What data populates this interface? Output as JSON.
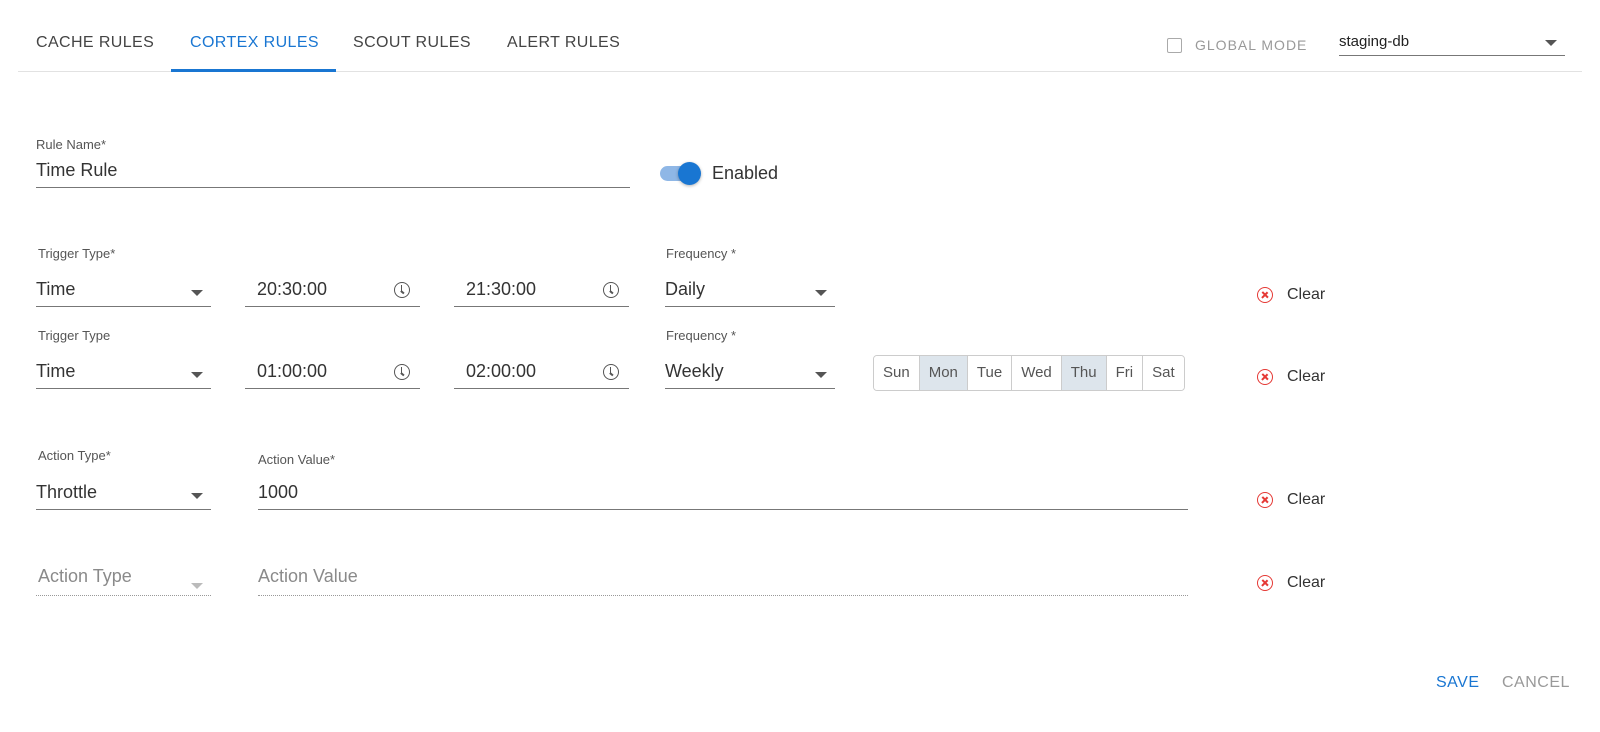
{
  "tabs": [
    {
      "label": "CACHE RULES"
    },
    {
      "label": "CORTEX RULES"
    },
    {
      "label": "SCOUT RULES"
    },
    {
      "label": "ALERT RULES"
    }
  ],
  "active_tab": "CORTEX RULES",
  "global_mode": {
    "label": "GLOBAL MODE",
    "checked": false
  },
  "db_select": {
    "value": "staging-db"
  },
  "rule_name": {
    "label": "Rule Name",
    "required_mark": "*",
    "value": "Time Rule"
  },
  "enabled_toggle": {
    "label": "Enabled",
    "on": true
  },
  "triggers": [
    {
      "type_label": "Trigger Type*",
      "type_value": "Time",
      "start": "20:30:00",
      "end": "21:30:00",
      "freq_label": "Frequency *",
      "freq_value": "Daily",
      "clear": "Clear"
    },
    {
      "type_label": "Trigger Type",
      "type_value": "Time",
      "start": "01:00:00",
      "end": "02:00:00",
      "freq_label": "Frequency *",
      "freq_value": "Weekly",
      "clear": "Clear",
      "days": [
        {
          "label": "Sun",
          "selected": false
        },
        {
          "label": "Mon",
          "selected": true
        },
        {
          "label": "Tue",
          "selected": false
        },
        {
          "label": "Wed",
          "selected": false
        },
        {
          "label": "Thu",
          "selected": true
        },
        {
          "label": "Fri",
          "selected": false
        },
        {
          "label": "Sat",
          "selected": false
        }
      ]
    }
  ],
  "actions": [
    {
      "type_label": "Action Type*",
      "type_value": "Throttle",
      "value_label": "Action Value",
      "value_required": "*",
      "value": "1000",
      "clear": "Clear"
    },
    {
      "type_placeholder": "Action Type",
      "value_placeholder": "Action Value",
      "clear": "Clear"
    }
  ],
  "footer": {
    "save": "SAVE",
    "cancel": "CANCEL"
  },
  "colors": {
    "accent": "#1976d2",
    "danger": "#e53935",
    "day_selected": "#dde5ec"
  }
}
